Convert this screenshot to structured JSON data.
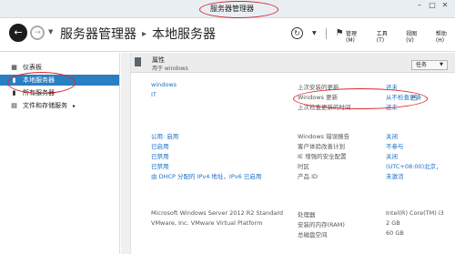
{
  "window": {
    "title": "服务器管理器",
    "controls": [
      "–",
      "□",
      "✕"
    ]
  },
  "header": {
    "breadcrumb_root": "服务器管理器",
    "breadcrumb_current": "本地服务器",
    "menu": [
      "管理(M)",
      "工具(T)",
      "视图(V)",
      "帮助(H)"
    ]
  },
  "sidebar": {
    "items": [
      {
        "label": "仪表板",
        "icon": "dashboard-icon"
      },
      {
        "label": "本地服务器",
        "icon": "server-icon"
      },
      {
        "label": "所有服务器",
        "icon": "servers-icon"
      },
      {
        "label": "文件和存储服务",
        "icon": "storage-icon"
      }
    ]
  },
  "panel": {
    "title": "属性",
    "subtitle": "用于 windows",
    "tasks_label": "任务",
    "computer_name": "windows",
    "workgroup": "IT",
    "updates": [
      {
        "label": "上次安装的更新",
        "value": "还未"
      },
      {
        "label": "Windows 更新",
        "value": "从不检查更新"
      },
      {
        "label": "上次检查更新的时间",
        "value": "还未"
      }
    ],
    "left_values": [
      "公用: 启用",
      "已启用",
      "已禁用",
      "已禁用",
      "由 DHCP 分配的 IPv4 地址，IPv6 已启用"
    ],
    "right_rows": [
      {
        "label": "Windows 错误报告",
        "value": "关闭"
      },
      {
        "label": "客户体验改善计划",
        "value": "不参与"
      },
      {
        "label": "IE 增强的安全配置",
        "value": "关闭"
      },
      {
        "label": "时区",
        "value": "(UTC+08:00)北京，"
      },
      {
        "label": "产品 ID",
        "value": "未激活"
      }
    ],
    "os": "Microsoft Windows Server 2012 R2 Standard",
    "hardware": "VMware, Inc. VMware Virtual Platform",
    "hw_rows": [
      {
        "label": "处理器",
        "value": "Intel(R) Core(TM) i3"
      },
      {
        "label": "安装的内存(RAM)",
        "value": "2 GB"
      },
      {
        "label": "总磁盘空间",
        "value": "60 GB"
      }
    ]
  }
}
